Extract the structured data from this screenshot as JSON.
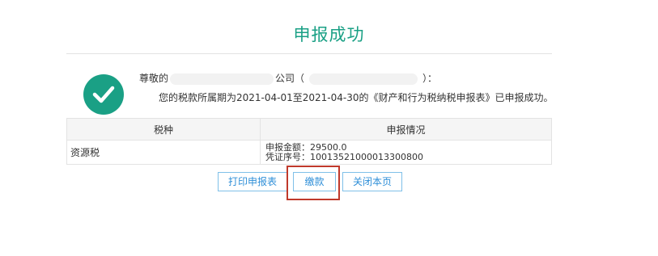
{
  "header": {
    "title": "申报成功"
  },
  "notice": {
    "salutation": "尊敬的",
    "company_suffix": "公司（",
    "company_close": "）：",
    "message": "您的税款所属期为2021-04-01至2021-04-30的《财产和行为税纳税申报表》已申报成功。"
  },
  "table": {
    "headers": [
      "税种",
      "申报情况"
    ],
    "rows": [
      {
        "tax_type": "资源税",
        "amount_line": "申报金额：29500.0",
        "voucher_line": "凭证序号：10013521000013300800"
      }
    ]
  },
  "actions": {
    "print_label": "打印申报表",
    "pay_label": "缴款",
    "close_label": "关闭本页"
  },
  "colors": {
    "accent": "#1aa085",
    "button_text": "#2f8fd8",
    "highlight": "#c0392b"
  },
  "icons": {
    "success": "success-check-icon"
  }
}
